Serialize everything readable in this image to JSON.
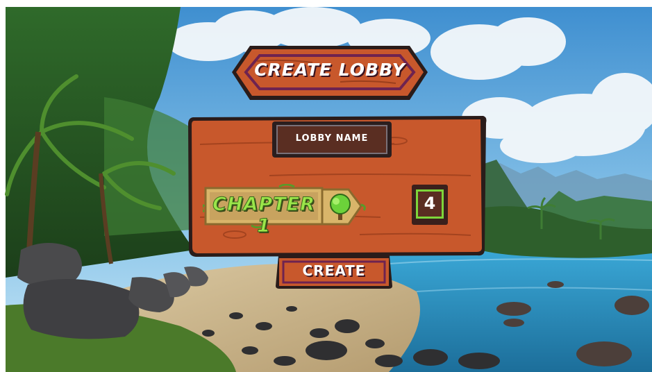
{
  "screen": {
    "title": "CREATE LOBBY",
    "lobby_name_label": "LOBBY NAME",
    "chapter_label": "CHAPTER 1",
    "chapter_icon": "tree-icon",
    "player_count": "4",
    "create_label": "CREATE"
  },
  "colors": {
    "wood": "#c8582c",
    "wood_dark": "#8a2e16",
    "outline": "#2a1c1a",
    "chapter_green": "#9be54a",
    "sky": "#5aa6d8"
  }
}
